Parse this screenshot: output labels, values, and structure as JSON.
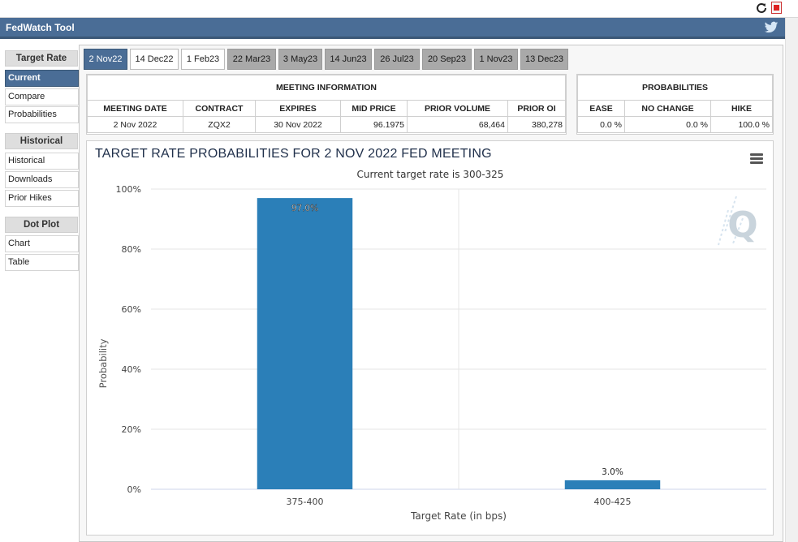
{
  "app": {
    "title": "FedWatch Tool"
  },
  "icons": {
    "reload": "reload-icon",
    "pdf": "pdf-icon",
    "twitter": "twitter-icon",
    "menu": "hamburger-menu-icon"
  },
  "colors": {
    "header": "#4a6d96",
    "bar": "#2b7fb8"
  },
  "sidebar": {
    "target_rate": {
      "heading": "Target Rate",
      "items": [
        "Current",
        "Compare",
        "Probabilities"
      ]
    },
    "historical": {
      "heading": "Historical",
      "items": [
        "Historical",
        "Downloads",
        "Prior Hikes"
      ]
    },
    "dot_plot": {
      "heading": "Dot Plot",
      "items": [
        "Chart",
        "Table"
      ]
    }
  },
  "tabs": [
    "2 Nov22",
    "14 Dec22",
    "1 Feb23",
    "22 Mar23",
    "3 May23",
    "14 Jun23",
    "26 Jul23",
    "20 Sep23",
    "1 Nov23",
    "13 Dec23"
  ],
  "meeting_info": {
    "title": "MEETING INFORMATION",
    "headers": [
      "MEETING DATE",
      "CONTRACT",
      "EXPIRES",
      "MID PRICE",
      "PRIOR VOLUME",
      "PRIOR OI"
    ],
    "row": [
      "2 Nov 2022",
      "ZQX2",
      "30 Nov 2022",
      "96.1975",
      "68,464",
      "380,278"
    ]
  },
  "probabilities": {
    "title": "PROBABILITIES",
    "headers": [
      "EASE",
      "NO CHANGE",
      "HIKE"
    ],
    "row": [
      "0.0 %",
      "0.0 %",
      "100.0 %"
    ]
  },
  "chart_data": {
    "type": "bar",
    "title": "TARGET RATE PROBABILITIES FOR 2 NOV 2022 FED MEETING",
    "subtitle": "Current target rate is 300-325",
    "categories": [
      "375-400",
      "400-425"
    ],
    "values": [
      97.0,
      3.0
    ],
    "data_labels": [
      "97.0%",
      "3.0%"
    ],
    "xlabel": "Target Rate (in bps)",
    "ylabel": "Probability",
    "ylim": [
      0,
      100
    ],
    "yticks": [
      "0%",
      "20%",
      "40%",
      "60%",
      "80%",
      "100%"
    ],
    "grid": true,
    "watermark": "Q"
  }
}
